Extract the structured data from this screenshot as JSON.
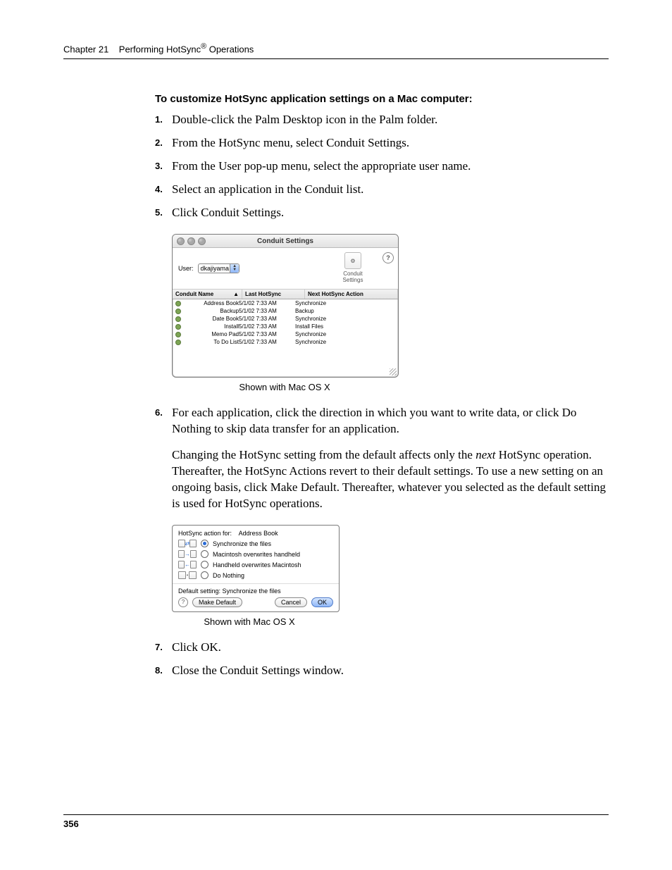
{
  "header": {
    "chapter_label": "Chapter 21",
    "title_prefix": "Performing HotSync",
    "reg_mark": "®",
    "title_suffix": " Operations"
  },
  "subheading": "To customize HotSync application settings on a Mac computer:",
  "steps": {
    "s1": "Double-click the Palm Desktop icon in the Palm folder.",
    "s2": "From the HotSync menu, select Conduit Settings.",
    "s3": "From the User pop-up menu, select the appropriate user name.",
    "s4": "Select an application in the Conduit list.",
    "s5": "Click Conduit Settings.",
    "s6": "For each application, click the direction in which you want to write data, or click Do Nothing to skip data transfer for an application.",
    "s6_para_before": "Changing the HotSync setting from the default affects only the ",
    "s6_para_em": "next",
    "s6_para_after": " HotSync operation. Thereafter, the HotSync Actions revert to their default settings. To use a new setting on an ongoing basis, click Make Default. Thereafter, whatever you selected as the default setting is used for HotSync operations.",
    "s7": "Click OK.",
    "s8": "Close the Conduit Settings window."
  },
  "captions": {
    "c1": "Shown with Mac OS X",
    "c2": "Shown with Mac OS X"
  },
  "conduit_window": {
    "title": "Conduit Settings",
    "user_label": "User:",
    "user_value": "dkajiyama",
    "toolicon_label": "Conduit Settings",
    "columns": {
      "name": "Conduit Name",
      "last": "Last HotSync",
      "next": "Next HotSync Action"
    },
    "rows": [
      {
        "name": "Address Book",
        "last": "5/1/02 7:33 AM",
        "next": "Synchronize"
      },
      {
        "name": "Backup",
        "last": "5/1/02 7:33 AM",
        "next": "Backup"
      },
      {
        "name": "Date Book",
        "last": "5/1/02 7:33 AM",
        "next": "Synchronize"
      },
      {
        "name": "Install",
        "last": "5/1/02 7:33 AM",
        "next": "Install Files"
      },
      {
        "name": "Memo Pad",
        "last": "5/1/02 7:33 AM",
        "next": "Synchronize"
      },
      {
        "name": "To Do List",
        "last": "5/1/02 7:33 AM",
        "next": "Synchronize"
      }
    ]
  },
  "action_dialog": {
    "header_prefix": "HotSync action for:",
    "header_app": "Address Book",
    "options": {
      "opt1": "Synchronize the files",
      "opt2": "Macintosh overwrites handheld",
      "opt3": "Handheld overwrites Macintosh",
      "opt4": "Do Nothing"
    },
    "default_text": "Default setting:  Synchronize the files",
    "make_default": "Make Default",
    "cancel": "Cancel",
    "ok": "OK"
  },
  "page_number": "356"
}
